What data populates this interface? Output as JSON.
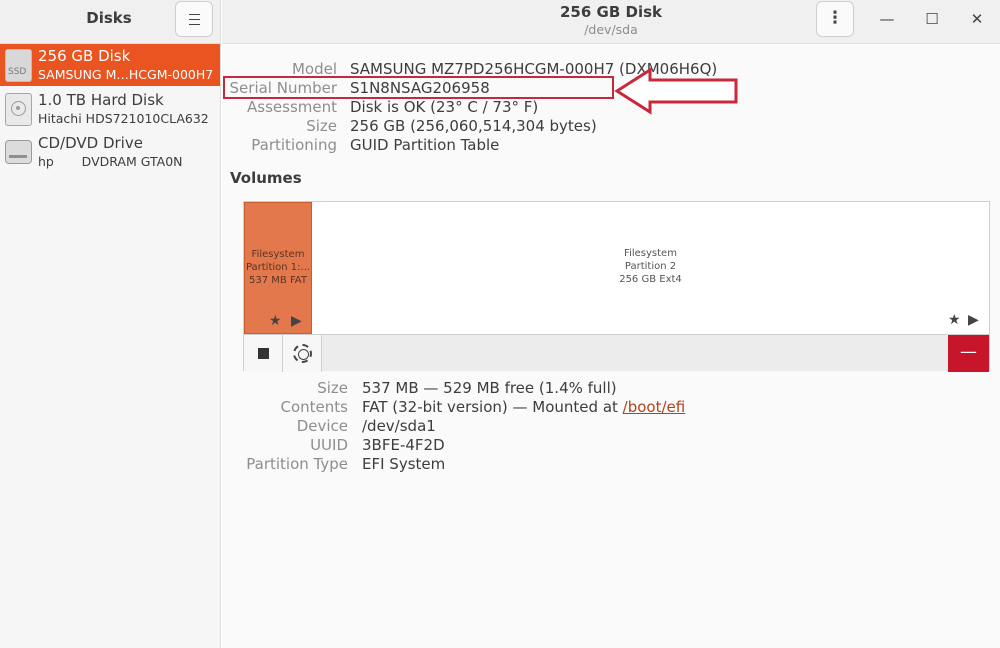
{
  "sidebar": {
    "title": "Disks",
    "menu_icon": "hamburger-menu-icon",
    "disks": [
      {
        "name": "256 GB Disk",
        "subtitle": "SAMSUNG M…HCGM-000H7",
        "icon": "ssd-icon",
        "icon_label": "SSD",
        "selected": true
      },
      {
        "name": "1.0 TB Hard Disk",
        "subtitle": "Hitachi HDS721010CLA632",
        "icon": "hard-disk-icon",
        "selected": false
      },
      {
        "name": "CD/DVD Drive",
        "subtitle": "hp       DVDRAM GTA0N",
        "icon": "optical-drive-icon",
        "selected": false
      }
    ]
  },
  "header": {
    "title": "256 GB Disk",
    "subtitle": "/dev/sda",
    "menu_icon": "kebab-menu-icon",
    "window_controls": {
      "minimize": "—",
      "maximize": "☐",
      "close": "✕"
    }
  },
  "disk_properties": [
    {
      "key": "Model",
      "value": "SAMSUNG MZ7PD256HCGM-000H7 (DXM06H6Q)"
    },
    {
      "key": "Serial Number",
      "value": "S1N8NSAG206958"
    },
    {
      "key": "Assessment",
      "value": "Disk is OK (23° C / 73° F)"
    },
    {
      "key": "Size",
      "value": "256 GB (256,060,514,304 bytes)"
    },
    {
      "key": "Partitioning",
      "value": "GUID Partition Table"
    }
  ],
  "volumes": {
    "title": "Volumes",
    "partitions": [
      {
        "line1": "Filesystem",
        "line2": "Partition 1:...",
        "line3": "537 MB FAT",
        "selected": true
      },
      {
        "line1": "Filesystem",
        "line2": "Partition 2",
        "line3": "256 GB Ext4",
        "selected": false
      }
    ],
    "toolbar": {
      "stop_icon": "stop-icon",
      "settings_icon": "gear-icon",
      "delete_label": "—"
    }
  },
  "partition_details": {
    "size": {
      "key": "Size",
      "value": "537 MB — 529 MB free (1.4% full)"
    },
    "contents": {
      "key": "Contents",
      "value_prefix": "FAT (32-bit version) — Mounted at ",
      "link": "/boot/efi"
    },
    "device": {
      "key": "Device",
      "value": "/dev/sda1"
    },
    "uuid": {
      "key": "UUID",
      "value": "3BFE-4F2D"
    },
    "partition_type": {
      "key": "Partition Type",
      "value": "EFI System"
    }
  },
  "colors": {
    "accent": "#e95420",
    "annotation": "#c8283a",
    "destructive": "#c7162b"
  }
}
